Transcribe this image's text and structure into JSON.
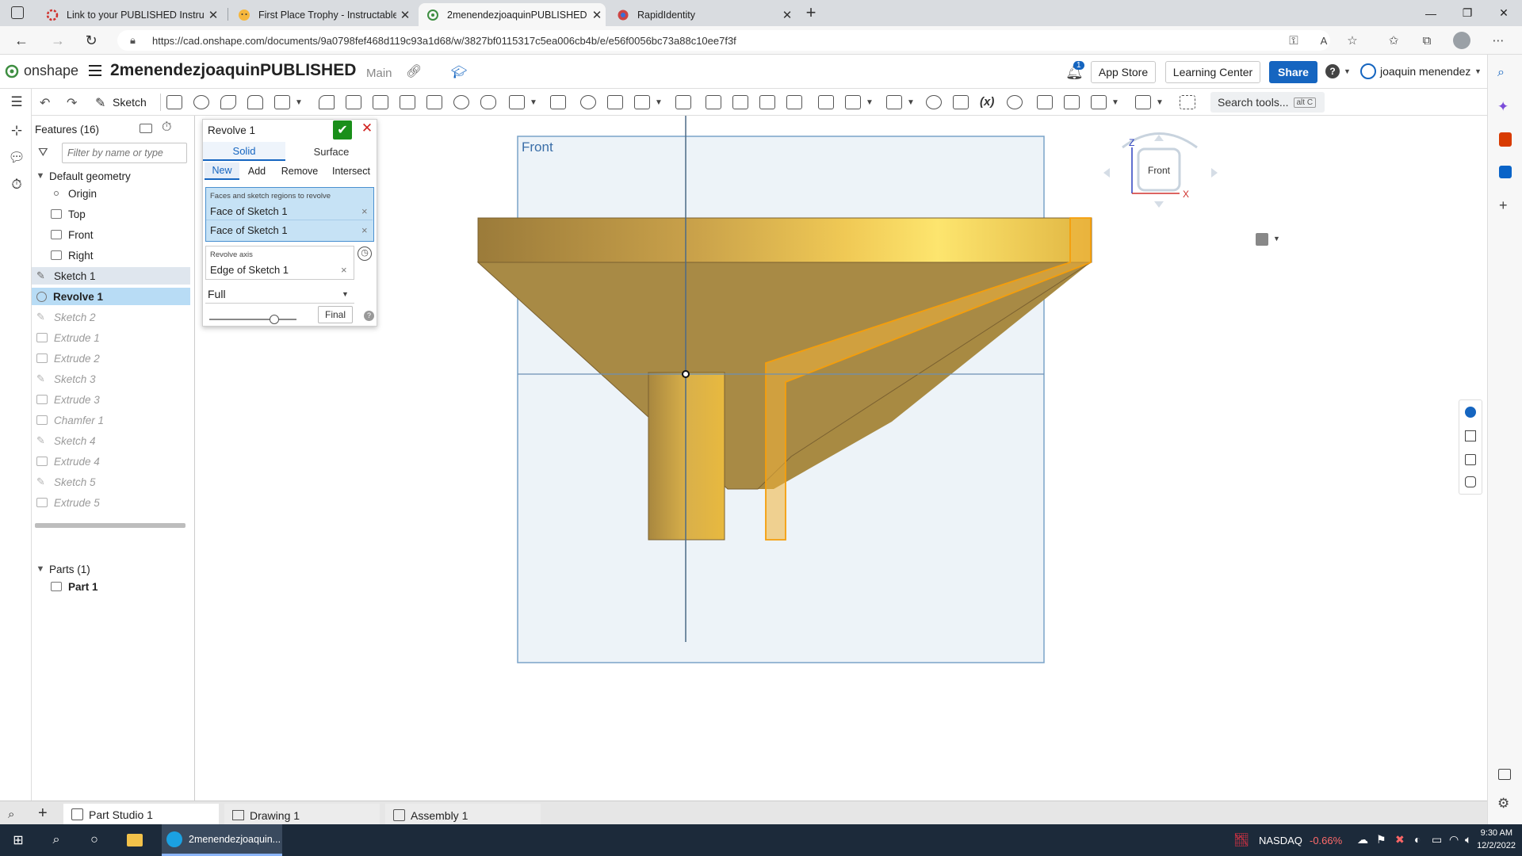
{
  "browser": {
    "tabs": [
      {
        "title": "Link to your PUBLISHED Instructa",
        "active": false
      },
      {
        "title": "First Place Trophy - Instructables",
        "active": false
      },
      {
        "title": "2menendezjoaquinPUBLISHED |",
        "active": true
      },
      {
        "title": "RapidIdentity",
        "active": false
      }
    ],
    "new_tab": "+",
    "url": "https://cad.onshape.com/documents/9a0798fef468d119c93a1d68/w/3827bf0115317c5ea006cb4b/e/e56f0056bc73a88c10ee7f3f"
  },
  "header": {
    "logo_text": "onshape",
    "doc_title": "2menendezjoaquinPUBLISHED",
    "branch": "Main",
    "notification_count": "1",
    "app_store": "App Store",
    "learning_center": "Learning Center",
    "share": "Share",
    "user": "joaquin menendez"
  },
  "toolbar": {
    "sketch_label": "Sketch",
    "search_label": "Search tools...",
    "search_shortcut": "alt C",
    "fx_label": "(x)"
  },
  "feature_list": {
    "header": "Features (16)",
    "filter_placeholder": "Filter by name or type",
    "default_geometry": "Default geometry",
    "items": [
      {
        "label": "Origin",
        "kind": "origin",
        "state": "normal",
        "indent": 2
      },
      {
        "label": "Top",
        "kind": "plane",
        "state": "normal",
        "indent": 2
      },
      {
        "label": "Front",
        "kind": "plane",
        "state": "normal",
        "indent": 2
      },
      {
        "label": "Right",
        "kind": "plane",
        "state": "normal",
        "indent": 2
      },
      {
        "label": "Sketch 1",
        "kind": "sketch",
        "state": "selected",
        "indent": 1
      },
      {
        "label": "Revolve 1",
        "kind": "revolve",
        "state": "current",
        "indent": 1
      },
      {
        "label": "Sketch 2",
        "kind": "sketch",
        "state": "rolled",
        "indent": 1
      },
      {
        "label": "Extrude 1",
        "kind": "extrude",
        "state": "rolled",
        "indent": 1
      },
      {
        "label": "Extrude 2",
        "kind": "extrude",
        "state": "rolled",
        "indent": 1
      },
      {
        "label": "Sketch 3",
        "kind": "sketch",
        "state": "rolled",
        "indent": 1
      },
      {
        "label": "Extrude 3",
        "kind": "extrude",
        "state": "rolled",
        "indent": 1
      },
      {
        "label": "Chamfer 1",
        "kind": "chamfer",
        "state": "rolled",
        "indent": 1
      },
      {
        "label": "Sketch 4",
        "kind": "sketch",
        "state": "rolled",
        "indent": 1
      },
      {
        "label": "Extrude 4",
        "kind": "extrude",
        "state": "rolled",
        "indent": 1
      },
      {
        "label": "Sketch 5",
        "kind": "sketch",
        "state": "rolled",
        "indent": 1
      },
      {
        "label": "Extrude 5",
        "kind": "extrude",
        "state": "rolled",
        "indent": 1
      }
    ],
    "parts_header": "Parts (1)",
    "parts": [
      {
        "label": "Part 1"
      }
    ]
  },
  "revolve_dialog": {
    "title": "Revolve 1",
    "body_types": [
      "Solid",
      "Surface"
    ],
    "active_body_type": "Solid",
    "operations": [
      "New",
      "Add",
      "Remove",
      "Intersect"
    ],
    "active_operation": "New",
    "faces_label": "Faces and sketch regions to revolve",
    "faces": [
      "Face of Sketch 1",
      "Face of Sketch 1"
    ],
    "axis_label": "Revolve axis",
    "axis_value": "Edge of Sketch 1",
    "revolve_type": "Full",
    "final_label": "Final",
    "remove_glyph": "×"
  },
  "viewport": {
    "plane_label": "Front",
    "view_cube_face": "Front",
    "axis_z": "Z",
    "axis_x": "X"
  },
  "tabs_bottom": [
    {
      "label": "Part Studio 1",
      "active": true
    },
    {
      "label": "Drawing 1",
      "active": false
    },
    {
      "label": "Assembly 1",
      "active": false
    }
  ],
  "taskbar": {
    "app_label": "2menendezjoaquin...",
    "ticker": "NASDAQ",
    "ticker_change": "-0.66%",
    "time": "9:30 AM",
    "date": "12/2/2022"
  },
  "colors": {
    "accent": "#1565c0",
    "gold_dark": "#9a7c3c",
    "gold_light": "#fce26a",
    "highlight": "#f5a623",
    "selection_blue": "#b8dcf5"
  }
}
